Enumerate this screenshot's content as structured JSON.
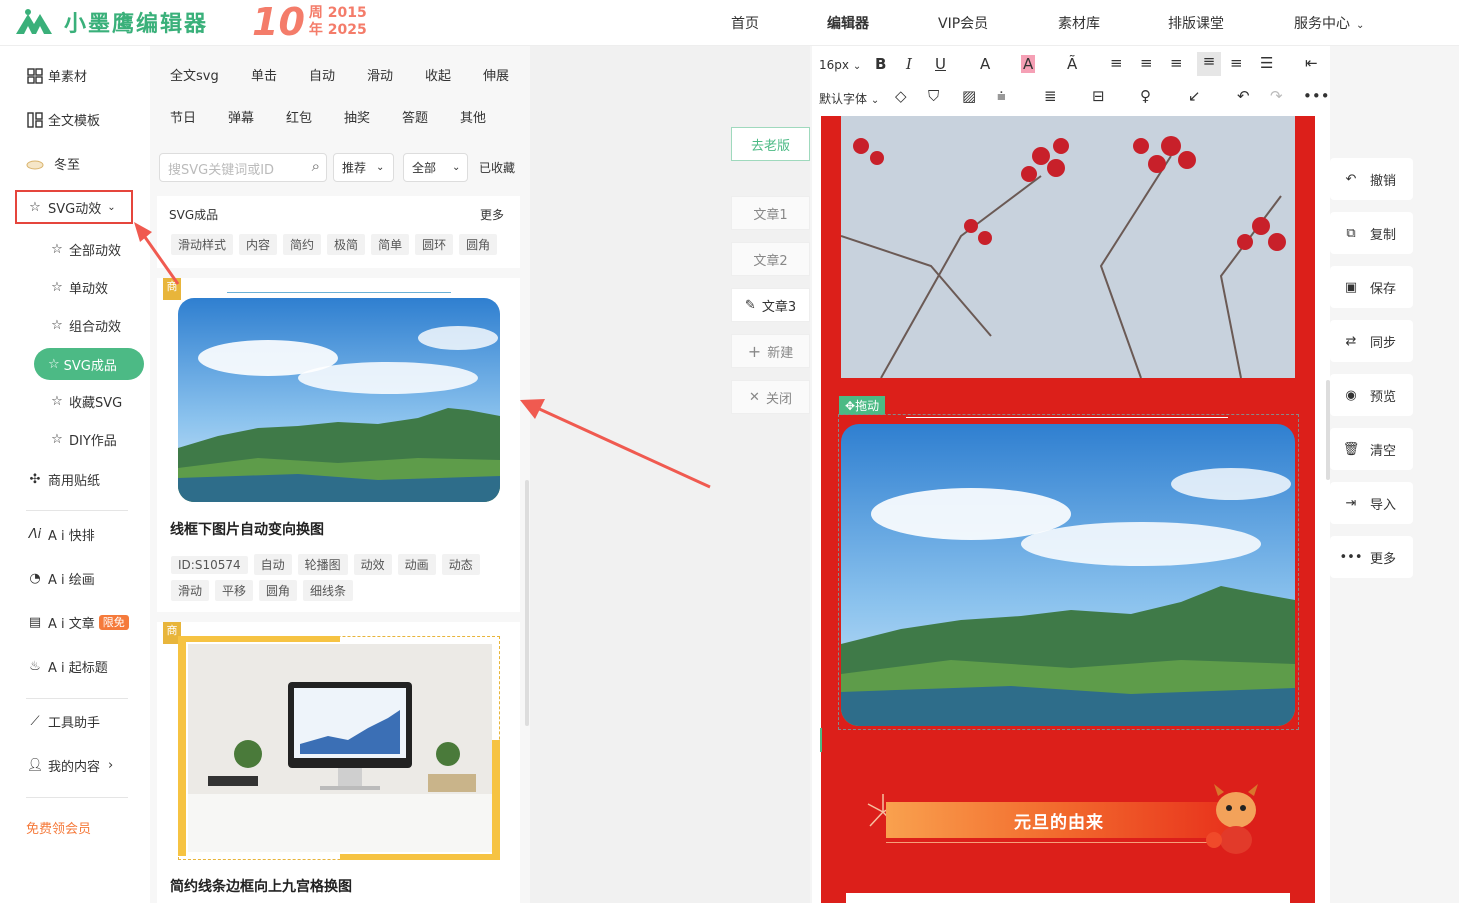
{
  "header": {
    "logo_text": "小墨鹰编辑器",
    "anniversary_number": "10",
    "anniversary_line1": "周 2015",
    "anniversary_line2": "年 2025",
    "nav": [
      "首页",
      "编辑器",
      "VIP会员",
      "素材库",
      "排版课堂",
      "服务中心"
    ]
  },
  "sidebar": {
    "items": {
      "single_material": "单素材",
      "full_template": "全文模板",
      "winter_solstice": "冬至",
      "svg_effects": "SVG动效",
      "all_effects": "全部动效",
      "single_effect": "单动效",
      "combo_effect": "组合动效",
      "svg_products": "SVG成品",
      "fav_svg": "收藏SVG",
      "diy_works": "DIY作品",
      "commercial_stickers": "商用贴纸",
      "ai_layout": "A i 快排",
      "ai_draw": "A i 绘画",
      "ai_article": "A i 文章",
      "ai_article_badge": "限免",
      "ai_title": "A i 起标题",
      "tool_helper": "工具助手",
      "my_content": "我的内容",
      "free_vip": "免费领会员"
    }
  },
  "panel": {
    "categories_row1": [
      "全文svg",
      "单击",
      "自动",
      "滑动",
      "收起",
      "伸展"
    ],
    "categories_row2": [
      "节日",
      "弹幕",
      "红包",
      "抽奖",
      "答题",
      "其他"
    ],
    "search_placeholder": "搜SVG关键词或ID",
    "filter_recommend": "推荐",
    "filter_all": "全部",
    "filter_collected": "已收藏",
    "section_title": "SVG成品",
    "section_more": "更多",
    "section_tags": [
      "滑动样式",
      "内容",
      "简约",
      "极简",
      "简单",
      "圆环",
      "圆角"
    ],
    "card1": {
      "badge": "商",
      "title": "线框下图片自动变向换图",
      "tags_row1": [
        "ID:S10574",
        "自动",
        "轮播图",
        "动效",
        "动画",
        "动态"
      ],
      "tags_row2": [
        "滑动",
        "平移",
        "圆角",
        "细线条"
      ]
    },
    "card2": {
      "badge": "商",
      "title": "简约线条边框向上九宫格换图"
    }
  },
  "articles": {
    "old_version": "去老版",
    "list": [
      "文章1",
      "文章2",
      "文章3"
    ],
    "new": "新建",
    "close": "关闭"
  },
  "editor": {
    "font_size": "16px",
    "default_font": "默认字体",
    "drag_label": "拖动",
    "banner_title": "元旦的由来"
  },
  "right_actions": [
    "撤销",
    "复制",
    "保存",
    "同步",
    "预览",
    "清空",
    "导入",
    "更多"
  ],
  "colors": {
    "brand_green": "#4cba85",
    "highlight_red": "#e5453c",
    "canvas_red": "#dc1f1a",
    "accent_orange": "#f57a3b"
  }
}
